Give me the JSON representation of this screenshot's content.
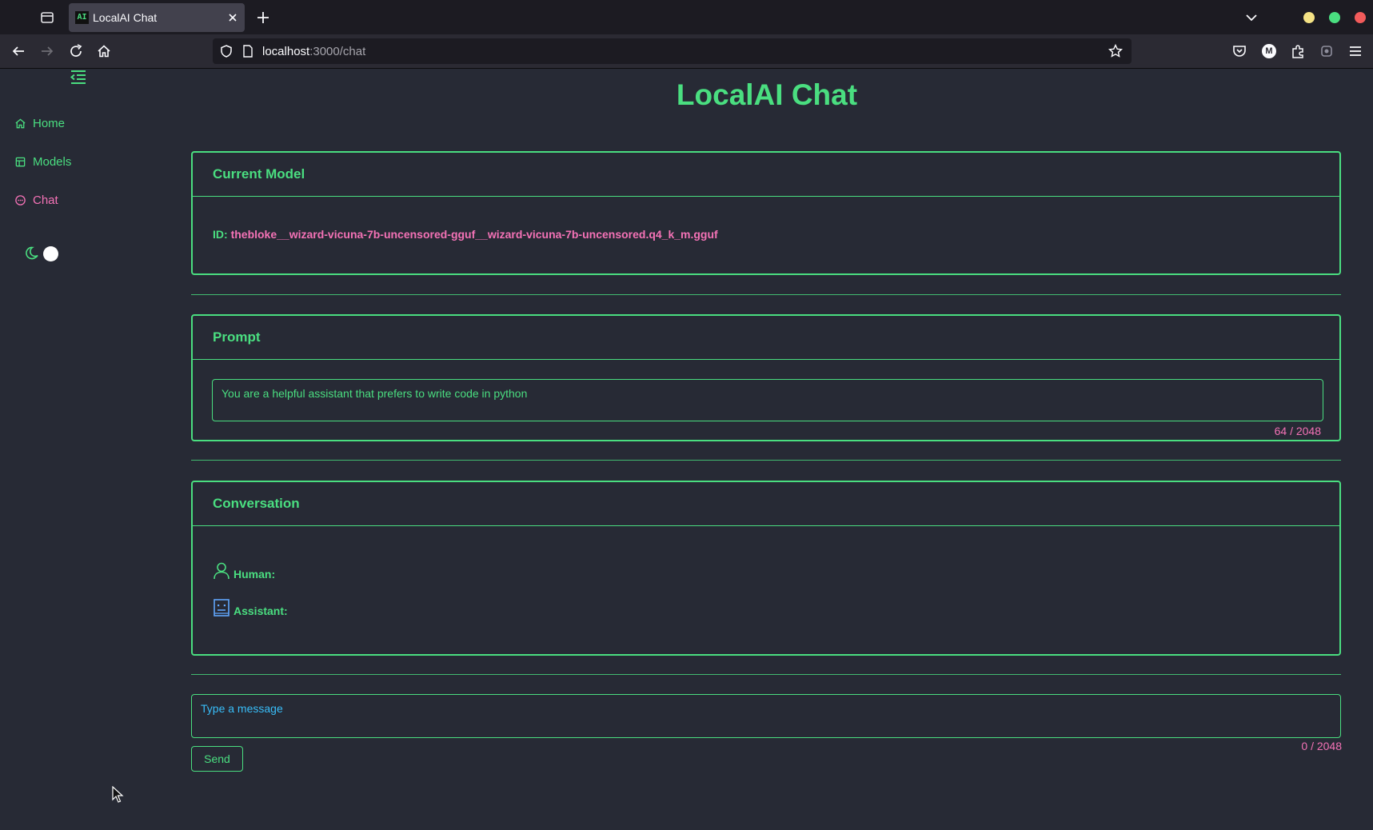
{
  "browser": {
    "tab_title": "LocalAI Chat",
    "tab_favicon_text": "AI",
    "url_host": "localhost",
    "url_path": ":3000/chat",
    "account_initial": "M"
  },
  "sidebar": {
    "items": [
      {
        "label": "Home",
        "icon": "home-icon",
        "active": false
      },
      {
        "label": "Models",
        "icon": "models-icon",
        "active": false
      },
      {
        "label": "Chat",
        "icon": "chat-icon",
        "active": true
      }
    ]
  },
  "page": {
    "title": "LocalAI Chat"
  },
  "current_model": {
    "header": "Current Model",
    "id_label": "ID:",
    "id_value": "thebloke__wizard-vicuna-7b-uncensored-gguf__wizard-vicuna-7b-uncensored.q4_k_m.gguf"
  },
  "prompt": {
    "header": "Prompt",
    "value": "You are a helpful assistant that prefers to write code in python",
    "count": "64 / 2048"
  },
  "conversation": {
    "header": "Conversation",
    "human_label": "Human:",
    "assistant_label": "Assistant:"
  },
  "composer": {
    "placeholder": "Type a message",
    "count": "0 / 2048",
    "send_label": "Send"
  },
  "colors": {
    "accent_green": "#4ade80",
    "accent_pink": "#f472b6",
    "background": "#272a35"
  }
}
